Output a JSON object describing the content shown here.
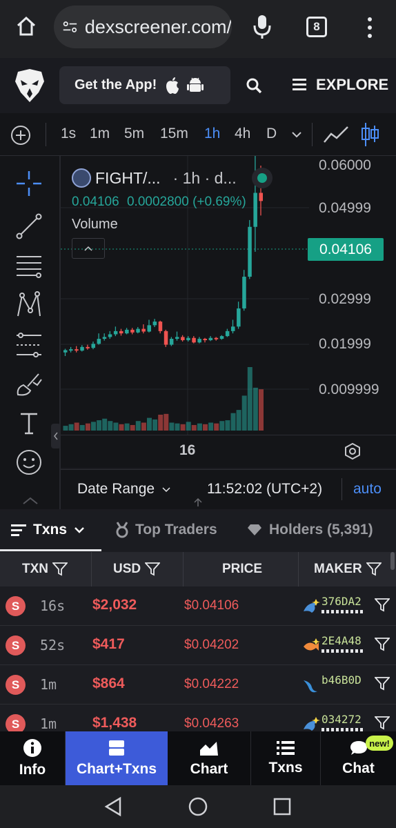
{
  "browser": {
    "url": "dexscreener.com/",
    "tab_count": "8"
  },
  "header": {
    "get_app": "Get the App!",
    "explore": "EXPLORE"
  },
  "timeframes": {
    "items": [
      "1s",
      "1m",
      "5m",
      "15m",
      "1h",
      "4h",
      "D"
    ],
    "active": "1h"
  },
  "chart": {
    "pair": "FIGHT/...",
    "interval": "· 1h · d...",
    "price": "0.04106",
    "change_abs": "0.0002800",
    "change_pct": "(+0.69%)",
    "volume_label": "Volume",
    "last_price_tag": "0.04106",
    "y_ticks": [
      "0.06000",
      "0.04999",
      "0.02999",
      "0.01999",
      "0.009999"
    ],
    "x_label": "16",
    "date_range": "Date Range",
    "time": "11:52:02 (UTC+2)",
    "auto": "auto",
    "colors": {
      "up": "#26a69a",
      "down": "#ef5350",
      "accent": "#4c8ef7"
    }
  },
  "tabs": {
    "txns": "Txns",
    "top_traders": "Top Traders",
    "holders": "Holders (5,391)"
  },
  "table": {
    "headers": {
      "txn": "TXN",
      "usd": "USD",
      "price": "PRICE",
      "maker": "MAKER"
    },
    "rows": [
      {
        "type": "S",
        "age": "16s",
        "usd": "$2,032",
        "price": "$0.04106",
        "maker": "376DA2"
      },
      {
        "type": "S",
        "age": "52s",
        "usd": "$417",
        "price": "$0.04202",
        "maker": "2E4A48"
      },
      {
        "type": "S",
        "age": "1m",
        "usd": "$864",
        "price": "$0.04222",
        "maker": "b46B0D"
      },
      {
        "type": "S",
        "age": "1m",
        "usd": "$1,438",
        "price": "$0.04263",
        "maker": "034272"
      }
    ]
  },
  "bottom_nav": {
    "info": "Info",
    "chart_txns": "Chart+Txns",
    "chart": "Chart",
    "txns": "Txns",
    "chat": "Chat",
    "chat_badge": "new!"
  }
}
